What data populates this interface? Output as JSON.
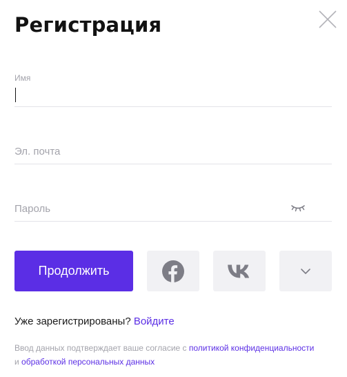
{
  "dialog": {
    "title": "Регистрация"
  },
  "form": {
    "name_label": "Имя",
    "name_value": "",
    "email_placeholder": "Эл. почта",
    "password_placeholder": "Пароль"
  },
  "actions": {
    "continue_label": "Продолжить"
  },
  "icons": {
    "close": "close-icon",
    "eye": "eye-closed-icon",
    "facebook": "facebook-icon",
    "vk": "vk-icon",
    "more": "chevron-down-icon"
  },
  "login": {
    "prompt": "Уже зарегистрированы? ",
    "link": "Войдите"
  },
  "consent": {
    "text_before": "Ввод данных подтверждает ваше согласие с ",
    "policy_link": "политикой конфиденциальности",
    "text_middle": " и ",
    "processing_link": "обработкой персональных данных"
  },
  "colors": {
    "accent": "#5b2ee5",
    "muted_text": "#a3a3ab",
    "social_bg": "#f1f1f4",
    "icon_gray": "#7d7d86"
  }
}
